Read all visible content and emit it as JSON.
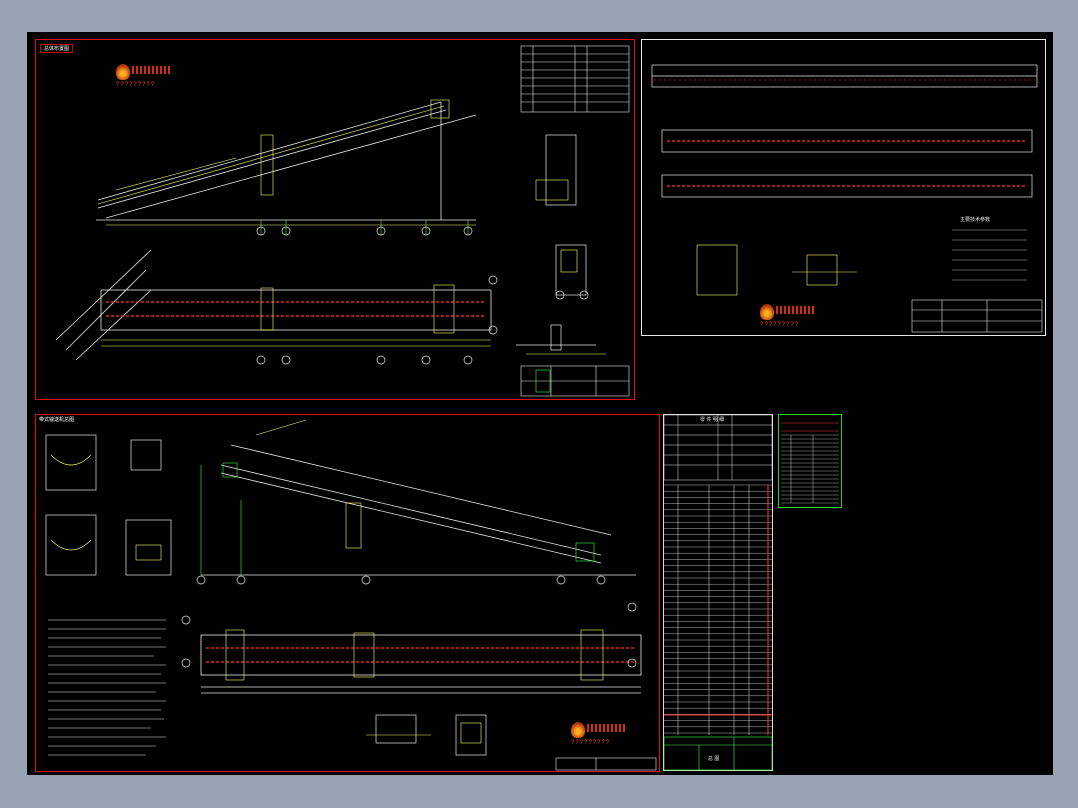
{
  "sheets": {
    "top_left": {
      "tag": "总体布置图",
      "logo_caption": "?????????"
    },
    "top_right": {
      "logo_caption": "?????????",
      "tech_table_title": "主要技术参数"
    },
    "bottom_left": {
      "tag": "带式输送机总图",
      "logo_caption": "?????????"
    },
    "parts_list": {
      "header": "零 件 明 细",
      "title_block": "总 图"
    }
  },
  "axis_markers": [
    "1",
    "2",
    "3",
    "4",
    "5"
  ],
  "colors": {
    "sheet_border": "#e01010",
    "line_yellow": "#ffff60",
    "line_green": "#40ff40",
    "line_white": "#e8e8e8",
    "background": "#000000",
    "frame": "#98a4b4"
  },
  "icons": [
    "flame-logo-icon"
  ]
}
